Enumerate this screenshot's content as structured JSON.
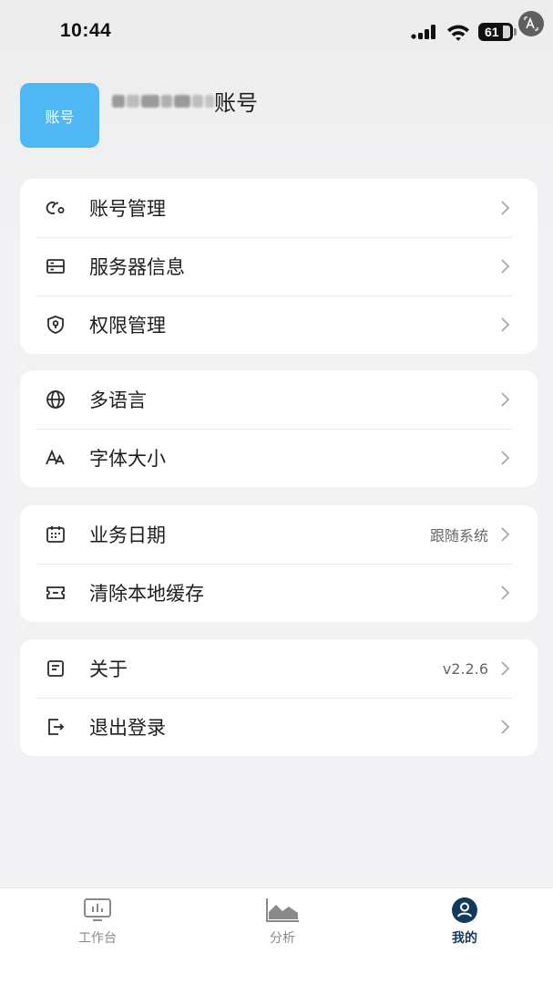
{
  "status_bar": {
    "time": "10:44",
    "battery": "61"
  },
  "profile": {
    "avatar_text": "账号",
    "account_suffix": "账号"
  },
  "groups": [
    {
      "items": [
        {
          "label": "账号管理",
          "icon": "account-link-icon"
        },
        {
          "label": "服务器信息",
          "icon": "server-icon"
        },
        {
          "label": "权限管理",
          "icon": "shield-key-icon"
        }
      ]
    },
    {
      "items": [
        {
          "label": "多语言",
          "icon": "globe-icon"
        },
        {
          "label": "字体大小",
          "icon": "font-size-icon"
        }
      ]
    },
    {
      "items": [
        {
          "label": "业务日期",
          "icon": "calendar-icon",
          "value": "跟随系统"
        },
        {
          "label": "清除本地缓存",
          "icon": "cache-ticket-icon"
        }
      ]
    },
    {
      "items": [
        {
          "label": "关于",
          "icon": "info-doc-icon",
          "value": "v2.2.6"
        },
        {
          "label": "退出登录",
          "icon": "logout-icon"
        }
      ]
    }
  ],
  "tabbar": {
    "tabs": [
      {
        "label": "工作台",
        "icon": "dashboard-icon",
        "active": false
      },
      {
        "label": "分析",
        "icon": "analysis-chart-icon",
        "active": false
      },
      {
        "label": "我的",
        "icon": "profile-icon",
        "active": true
      }
    ]
  },
  "colors": {
    "accent": "#14395f",
    "avatar_bg": "#4fb7f4",
    "background": "#f2f2f4"
  }
}
